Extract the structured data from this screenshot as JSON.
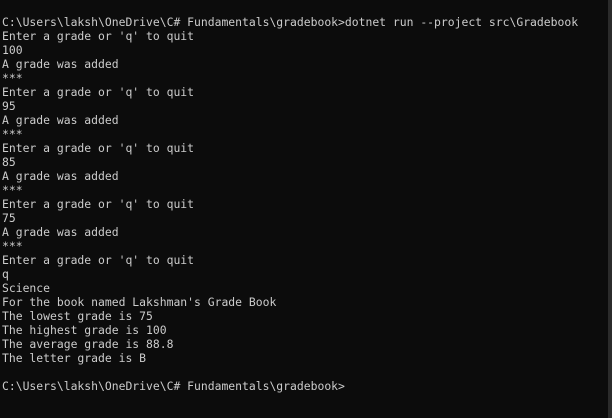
{
  "console": {
    "lines": [
      "C:\\Users\\laksh\\OneDrive\\C# Fundamentals\\gradebook>dotnet run --project src\\Gradebook",
      "Enter a grade or 'q' to quit",
      "100",
      "A grade was added",
      "***",
      "Enter a grade or 'q' to quit",
      "95",
      "A grade was added",
      "***",
      "Enter a grade or 'q' to quit",
      "85",
      "A grade was added",
      "***",
      "Enter a grade or 'q' to quit",
      "75",
      "A grade was added",
      "***",
      "Enter a grade or 'q' to quit",
      "q",
      "Science",
      "For the book named Lakshman's Grade Book",
      "The lowest grade is 75",
      "The highest grade is 100",
      "The average grade is 88.8",
      "The letter grade is B",
      "",
      "C:\\Users\\laksh\\OneDrive\\C# Fundamentals\\gradebook>"
    ]
  },
  "colors": {
    "background": "#0c0c0c",
    "text": "#cccccc"
  }
}
